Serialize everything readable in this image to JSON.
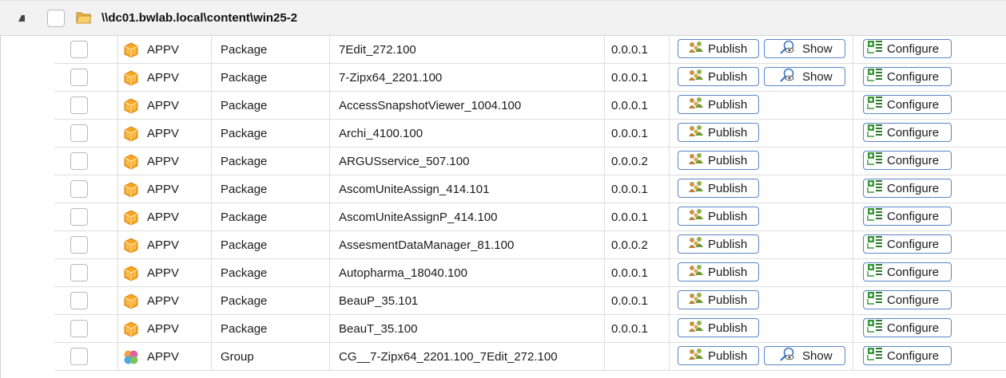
{
  "group": {
    "path": "\\\\dc01.bwlab.local\\content\\win25-2"
  },
  "labels": {
    "publish": "Publish",
    "show": "Show",
    "configure": "Configure"
  },
  "rows": [
    {
      "type": "APPV",
      "kind": "Package",
      "name": "7Edit_272.100",
      "version": "0.0.0.1",
      "icon": "package-icon",
      "show": true
    },
    {
      "type": "APPV",
      "kind": "Package",
      "name": "7-Zipx64_2201.100",
      "version": "0.0.0.1",
      "icon": "package-icon",
      "show": true
    },
    {
      "type": "APPV",
      "kind": "Package",
      "name": "AccessSnapshotViewer_1004.100",
      "version": "0.0.0.1",
      "icon": "package-icon",
      "show": false
    },
    {
      "type": "APPV",
      "kind": "Package",
      "name": "Archi_4100.100",
      "version": "0.0.0.1",
      "icon": "package-icon",
      "show": false
    },
    {
      "type": "APPV",
      "kind": "Package",
      "name": "ARGUSservice_507.100",
      "version": "0.0.0.2",
      "icon": "package-icon",
      "show": false
    },
    {
      "type": "APPV",
      "kind": "Package",
      "name": "AscomUniteAssign_414.101",
      "version": "0.0.0.1",
      "icon": "package-icon",
      "show": false
    },
    {
      "type": "APPV",
      "kind": "Package",
      "name": "AscomUniteAssignP_414.100",
      "version": "0.0.0.1",
      "icon": "package-icon",
      "show": false
    },
    {
      "type": "APPV",
      "kind": "Package",
      "name": "AssesmentDataManager_81.100",
      "version": "0.0.0.2",
      "icon": "package-icon",
      "show": false
    },
    {
      "type": "APPV",
      "kind": "Package",
      "name": "Autopharma_18040.100",
      "version": "0.0.0.1",
      "icon": "package-icon",
      "show": false
    },
    {
      "type": "APPV",
      "kind": "Package",
      "name": "BeauP_35.101",
      "version": "0.0.0.1",
      "icon": "package-icon",
      "show": false
    },
    {
      "type": "APPV",
      "kind": "Package",
      "name": "BeauT_35.100",
      "version": "0.0.0.1",
      "icon": "package-icon",
      "show": false
    },
    {
      "type": "APPV",
      "kind": "Group",
      "name": "CG__7-Zipx64_2201.100_7Edit_272.100",
      "version": "",
      "icon": "group-icon",
      "show": true
    }
  ]
}
